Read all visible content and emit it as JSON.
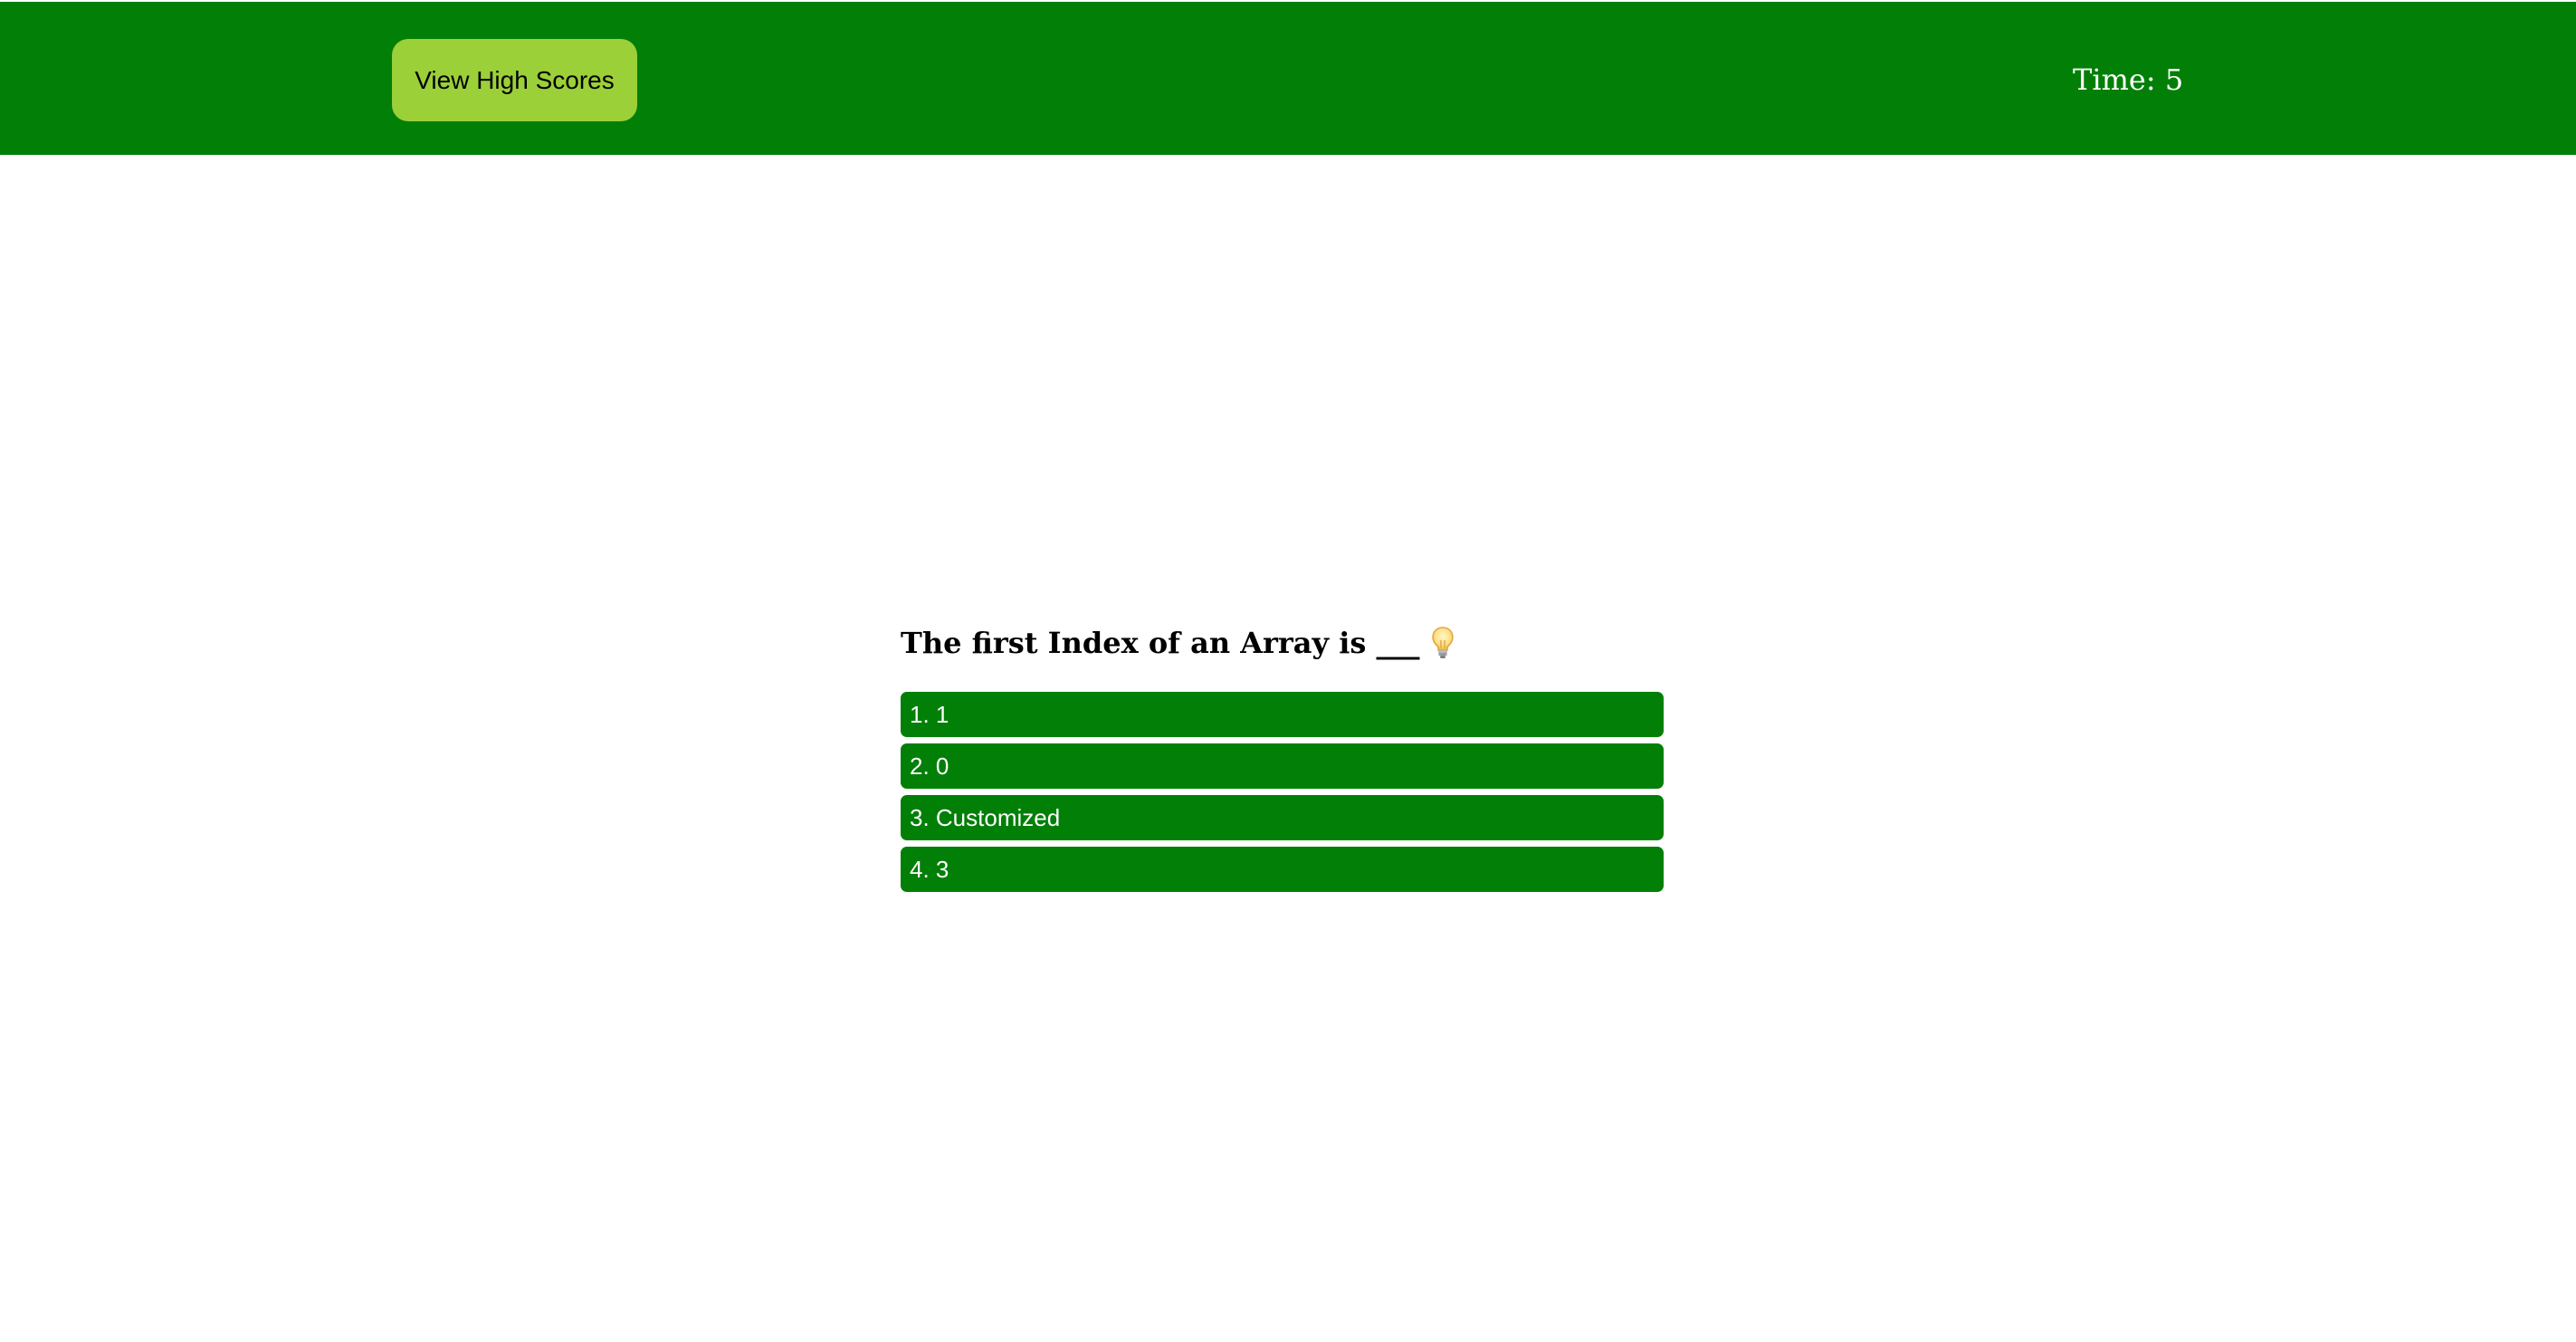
{
  "header": {
    "high_scores_label": "View High Scores",
    "timer_text": "Time: 5",
    "background_color": "#027f07",
    "button_color": "#9bd039"
  },
  "quiz": {
    "question": "The first Index of an Array is ___",
    "question_icon": "lightbulb-icon",
    "choices": [
      {
        "label": "1. 1"
      },
      {
        "label": "2. 0"
      },
      {
        "label": "3. Customized"
      },
      {
        "label": "4. 3"
      }
    ],
    "choice_color": "#027f07"
  }
}
